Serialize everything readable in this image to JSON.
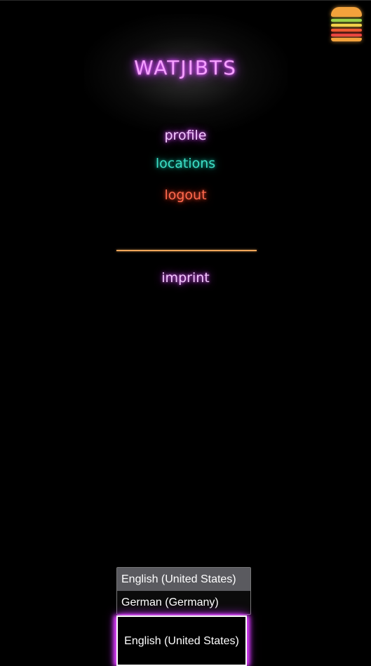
{
  "header": {
    "brand": "WATJIBTS",
    "menu_icon": "hamburger-menu-icon"
  },
  "nav": {
    "profile": "profile",
    "locations": "locations",
    "logout": "logout",
    "imprint": "imprint"
  },
  "language": {
    "selected": "English (United States)",
    "options": [
      "English (United States)",
      "German (Germany)"
    ]
  },
  "colors": {
    "background": "#000000",
    "brand": "#d23cff",
    "profile": "#e45cff",
    "locations": "#3de0c7",
    "logout": "#ff6a4e",
    "divider": "#f0a65a"
  }
}
